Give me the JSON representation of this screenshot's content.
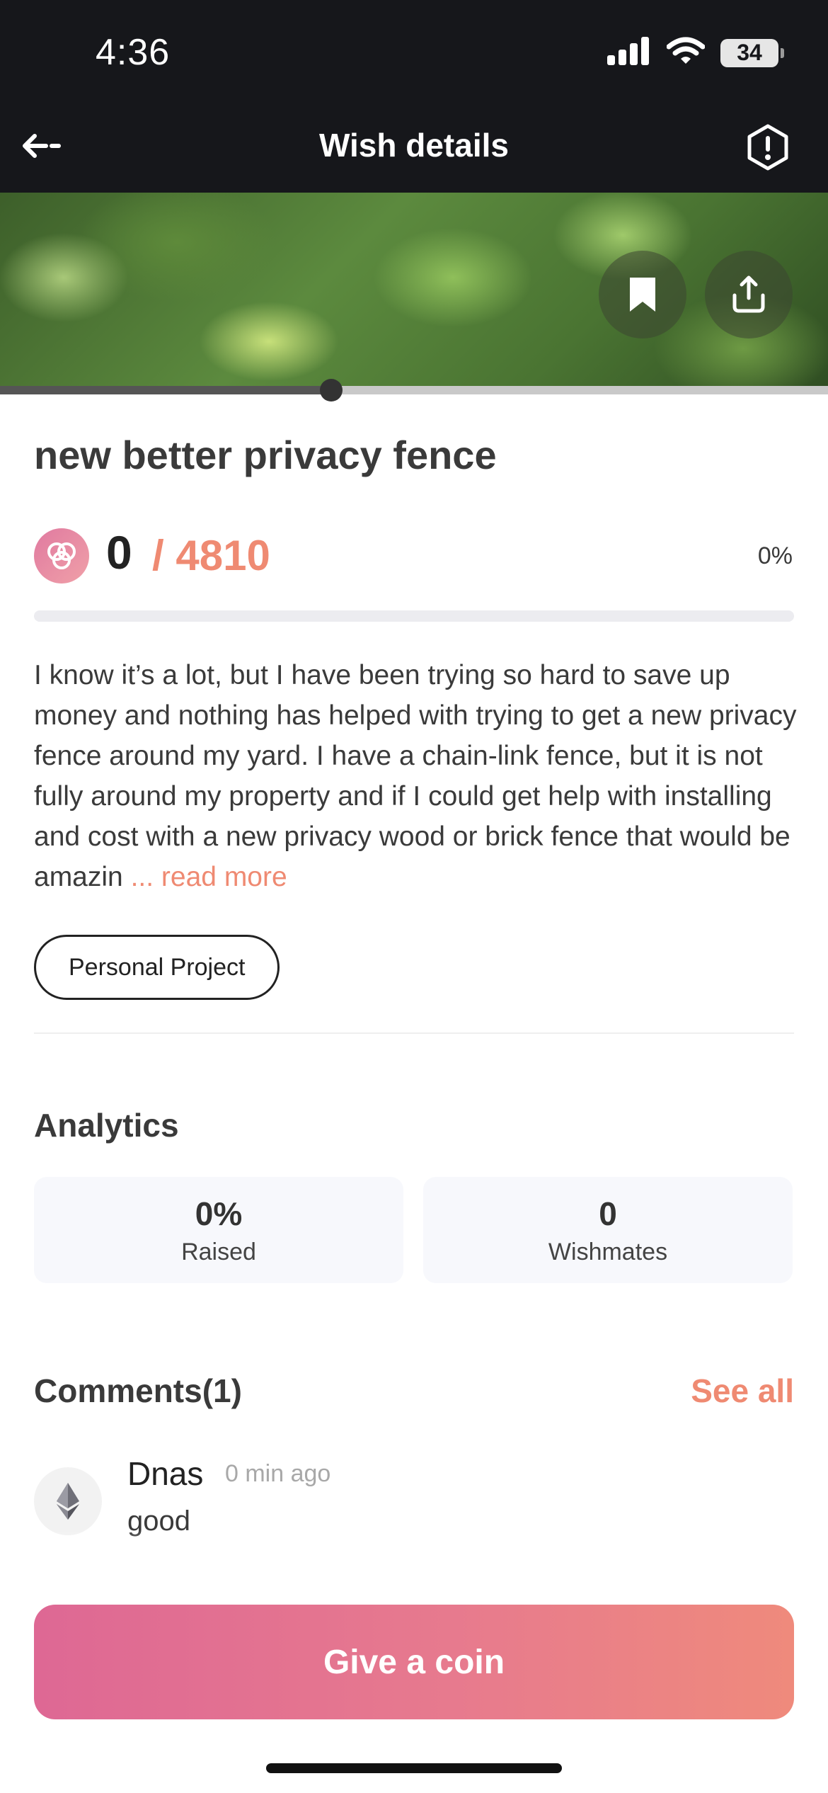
{
  "status_bar": {
    "time": "4:36",
    "battery": "34"
  },
  "header": {
    "title": "Wish details"
  },
  "media": {
    "progress_percent": 40
  },
  "wish": {
    "title": "new better privacy fence",
    "raised": "0",
    "goal": "/ 4810",
    "percent": "0%",
    "progress_value": 0,
    "description": "I know it’s a lot, but I have been trying so hard to save up money and nothing has helped with trying to get a new privacy fence around my yard. I have a chain-link fence, but it is not fully around my property and if I could get help with installing and cost with a new privacy wood or brick fence that would be amazin",
    "read_more": "... read more",
    "tag": "Personal Project"
  },
  "analytics": {
    "title": "Analytics",
    "stats": [
      {
        "value": "0%",
        "label": "Raised"
      },
      {
        "value": "0",
        "label": "Wishmates"
      }
    ]
  },
  "comments": {
    "title": "Comments(1)",
    "see_all": "See all",
    "items": [
      {
        "user": "Dnas",
        "time": "0 min ago",
        "text": "good"
      }
    ]
  },
  "cta": {
    "label": "Give a coin"
  },
  "colors": {
    "accent": "#ef8a72",
    "cta_start": "#de6894",
    "cta_end": "#ef8a7c",
    "header_bg": "#16171b"
  }
}
